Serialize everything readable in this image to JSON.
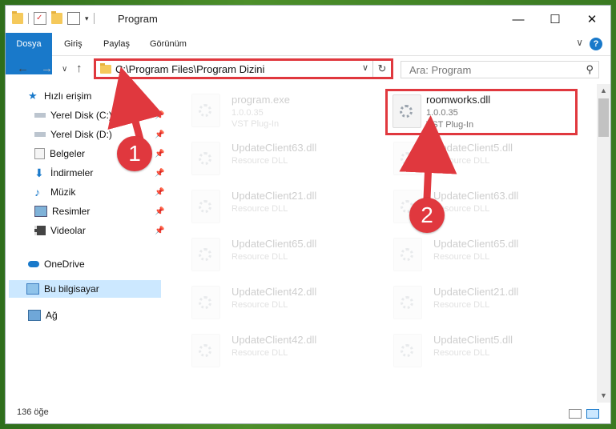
{
  "window": {
    "title": "Program",
    "minimize": "—",
    "maximize": "☐",
    "close": "✕"
  },
  "ribbon": {
    "tabs": [
      "Dosya",
      "Giriş",
      "Paylaş",
      "Görünüm"
    ],
    "help": "?",
    "chevron": "∨"
  },
  "address": {
    "path": "C:\\Program Files\\Program Dizini",
    "dropdown": "∨",
    "refresh": "↻"
  },
  "search": {
    "placeholder": "Ara: Program",
    "icon": "⚲"
  },
  "nav": {
    "back": "←",
    "forward": "→",
    "recent": "∨",
    "up": "↑"
  },
  "sidebar": {
    "quick_access": "Hızlı erişim",
    "items": [
      {
        "label": "Yerel Disk (C:)",
        "icon": "drive-icon"
      },
      {
        "label": "Yerel Disk (D:)",
        "icon": "drive-icon"
      },
      {
        "label": "Belgeler",
        "icon": "documents-icon"
      },
      {
        "label": "İndirmeler",
        "icon": "downloads-icon"
      },
      {
        "label": "Müzik",
        "icon": "music-icon"
      },
      {
        "label": "Resimler",
        "icon": "pictures-icon"
      },
      {
        "label": "Videolar",
        "icon": "videos-icon"
      }
    ],
    "onedrive": "OneDrive",
    "this_pc": "Bu bilgisayar",
    "network": "Ağ"
  },
  "files": {
    "top_left": {
      "name": "program.exe",
      "version": "1.0.0.35",
      "type": "VST Plug-In"
    },
    "highlight": {
      "name": "roomworks.dll",
      "version": "1.0.0.35",
      "type": "VST Plug-In"
    },
    "grid": [
      {
        "name": "UpdateClient63.dll",
        "type": "Resource DLL"
      },
      {
        "name": "UpdateClient5.dll",
        "type": "Resource DLL"
      },
      {
        "name": "UpdateClient21.dll",
        "type": "Resource DLL"
      },
      {
        "name": "UpdateClient63.dll",
        "type": "Resource DLL"
      },
      {
        "name": "UpdateClient65.dll",
        "type": "Resource DLL"
      },
      {
        "name": "UpdateClient65.dll",
        "type": "Resource DLL"
      },
      {
        "name": "UpdateClient42.dll",
        "type": "Resource DLL"
      },
      {
        "name": "UpdateClient21.dll",
        "type": "Resource DLL"
      },
      {
        "name": "UpdateClient42.dll",
        "type": "Resource DLL"
      },
      {
        "name": "UpdateClient5.dll",
        "type": "Resource DLL"
      }
    ]
  },
  "status": {
    "count": "136 öğe"
  },
  "annotations": {
    "step1": "1",
    "step2": "2",
    "color": "#e0383e"
  }
}
